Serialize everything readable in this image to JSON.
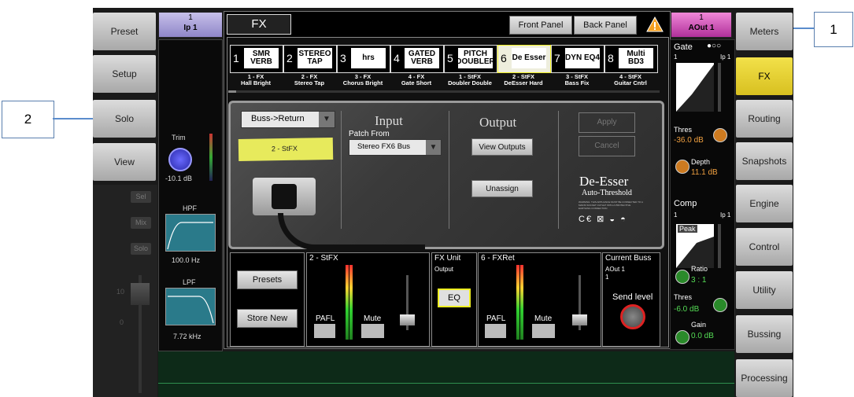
{
  "callouts": {
    "one": "1",
    "two": "2"
  },
  "left_nav": [
    "Preset",
    "Setup",
    "Solo",
    "View"
  ],
  "right_nav": [
    "Meters",
    "FX",
    "Routing",
    "Snapshots",
    "Engine",
    "Control",
    "Utility",
    "Bussing",
    "Processing"
  ],
  "active_right": "FX",
  "input_channel": {
    "number": "1",
    "name": "Ip 1"
  },
  "output_channel": {
    "number": "1",
    "name": "AOut 1"
  },
  "trim": {
    "label": "Trim",
    "value": "-10.1 dB"
  },
  "hpf": {
    "label": "HPF",
    "value": "100.0 Hz"
  },
  "lpf": {
    "label": "LPF",
    "value": "7.72 kHz"
  },
  "strip_buttons": [
    "Sel",
    "Mix",
    "Solo"
  ],
  "fader_scale": [
    "10",
    "0"
  ],
  "fx_header": {
    "title": "FX",
    "front_panel": "Front Panel",
    "back_panel": "Back Panel"
  },
  "fx_slots": [
    {
      "num": "1",
      "logo": "SMR VERB",
      "label1": "1 - FX",
      "label2": "Hall Bright"
    },
    {
      "num": "2",
      "logo": "STEREO TAP",
      "label1": "2 - FX",
      "label2": "Stereo Tap"
    },
    {
      "num": "3",
      "logo": "hrs",
      "label1": "3 - FX",
      "label2": "Chorus Bright"
    },
    {
      "num": "4",
      "logo": "GATED VERB",
      "label1": "4 - FX",
      "label2": "Gate Short"
    },
    {
      "num": "5",
      "logo": "PITCH DOUBLER",
      "label1": "1 - StFX",
      "label2": "Doubler Double"
    },
    {
      "num": "6",
      "logo": "De Esser",
      "label1": "2 - StFX",
      "label2": "DeEsser Hard"
    },
    {
      "num": "7",
      "logo": "DYN EQ4",
      "label1": "3 - StFX",
      "label2": "Bass Fix"
    },
    {
      "num": "8",
      "logo": "Multi BD3",
      "label1": "4 - StFX",
      "label2": "Guitar Cntrl"
    }
  ],
  "back_panel": {
    "mode_select": "Buss->Return",
    "tape_label": "2 - StFX",
    "input_title": "Input",
    "patch_from_label": "Patch From",
    "patch_from_value": "Stereo FX6 Bus",
    "output_title": "Output",
    "view_outputs": "View Outputs",
    "unassign": "Unassign",
    "apply": "Apply",
    "cancel": "Cancel",
    "device_name": "De-Esser",
    "device_sub": "Auto-Threshold",
    "warning": "WARNING: THIS APPLIANCE MUST BE CONNECTED TO A MAINS SOCKET OUTLET WITH A PROTECTIVE EARTHING CONNECTION"
  },
  "bottom": {
    "presets": "Presets",
    "store_new": "Store New",
    "send_title": "2 - StFX",
    "pafl": "PAFL",
    "mute": "Mute",
    "fx_unit": "FX Unit",
    "output": "Output",
    "eq": "EQ",
    "ret_title": "6 - FXRet",
    "current_buss": "Current Buss",
    "buss_name": "AOut 1",
    "buss_num": "1",
    "send_level": "Send level"
  },
  "right_panel": {
    "gate": "Gate",
    "gate_ch": "1",
    "gate_ip": "Ip 1",
    "thres": "Thres",
    "gate_thres_value": "-36.0 dB",
    "depth": "Depth",
    "depth_value": "11.1 dB",
    "comp": "Comp",
    "comp_ch": "1",
    "comp_ip": "Ip 1",
    "peak": "Peak",
    "ratio": "Ratio",
    "ratio_value": "3 : 1",
    "comp_thres_value": "-6.0 dB",
    "gain": "Gain",
    "gain_value": "0.0 dB"
  }
}
